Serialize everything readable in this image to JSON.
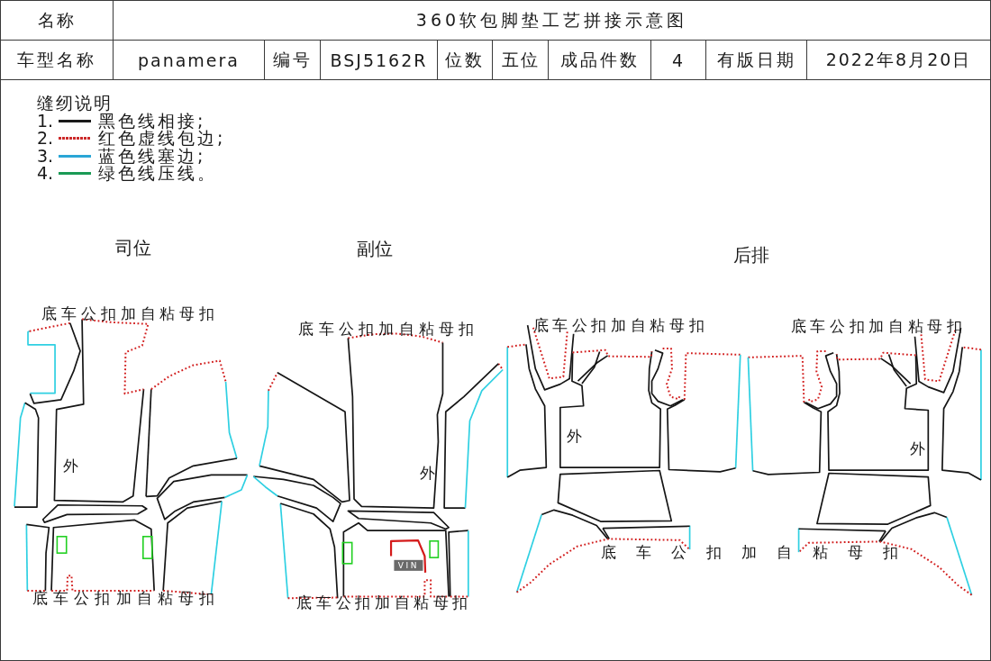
{
  "header": {
    "name_label": "名称",
    "title": "360软包脚垫工艺拼接示意图"
  },
  "info": [
    "车型名称",
    "panamera",
    "编号",
    "BSJ5162R",
    "位数",
    "五位",
    "成品件数",
    "4",
    "有版日期",
    "2022年8月20日"
  ],
  "legend": {
    "title": "缝纫说明",
    "items": [
      {
        "number": "1.",
        "kind": "solid",
        "color": "#1a1a1a",
        "text": "黑色线相接;"
      },
      {
        "number": "2.",
        "kind": "dotted",
        "color": "#cc2a2a",
        "text": "红色虚线包边;"
      },
      {
        "number": "3.",
        "kind": "solid",
        "color": "#2aa6d6",
        "text": "蓝色线塞边;"
      },
      {
        "number": "4.",
        "kind": "solid",
        "color": "#1a9a55",
        "text": "绿色线压线。"
      }
    ]
  },
  "sections": [
    {
      "title": "司位",
      "notes": [
        "底车公扣加自粘母扣",
        "底车公扣加自粘母扣"
      ],
      "side_labels": [
        "外"
      ]
    },
    {
      "title": "副位",
      "notes": [
        "底车公扣加自粘母扣",
        "底车公扣加自粘母扣"
      ],
      "side_labels": [
        "外"
      ],
      "vin": "VIN"
    },
    {
      "title": "后排",
      "notes": [
        "底车公扣加自粘母扣",
        "底车公扣加自粘母扣",
        "底 车 公 扣 加 自 粘 母 扣"
      ],
      "side_labels": [
        "外",
        "外"
      ]
    }
  ]
}
